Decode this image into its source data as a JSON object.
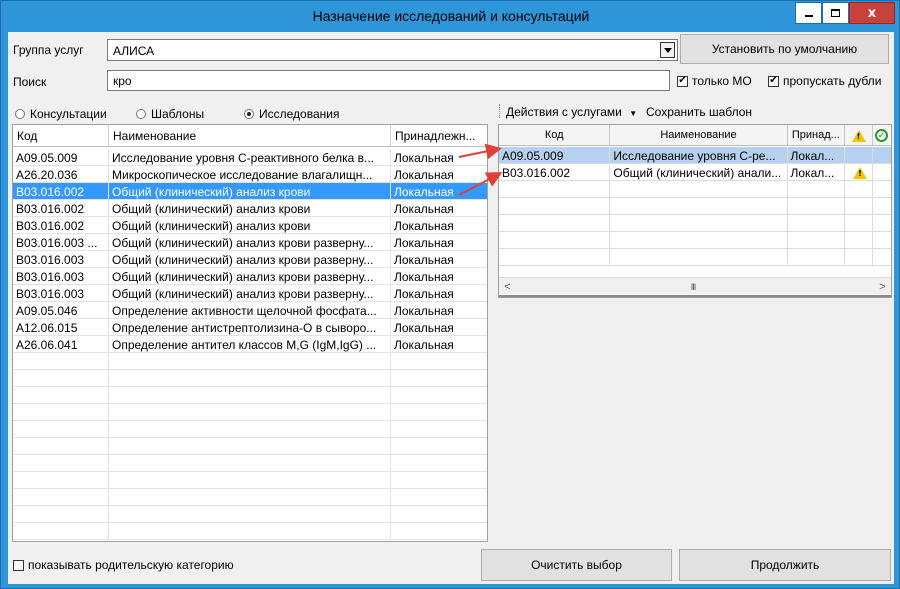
{
  "window": {
    "title": "Назначение исследований и консультаций",
    "close_glyph": "x"
  },
  "form": {
    "group_label": "Группа услуг",
    "group_value": "АЛИСА",
    "default_button": "Установить по умолчанию",
    "search_label": "Поиск",
    "search_value": "кро",
    "only_mo_label": "только МО",
    "only_mo_checked": true,
    "skip_dup_label": "пропускать дубли",
    "skip_dup_checked": true
  },
  "radios": [
    {
      "label": "Консультации",
      "selected": false
    },
    {
      "label": "Шаблоны",
      "selected": false
    },
    {
      "label": "Исследования",
      "selected": true
    }
  ],
  "left_grid": {
    "columns": [
      "Код",
      "Наименование",
      "Принадлежн..."
    ],
    "rows": [
      {
        "code": "A09.05.009",
        "name": "Исследование уровня С-реактивного белка в...",
        "owner": "Локальная",
        "selected": false
      },
      {
        "code": "A26.20.036",
        "name": "Микроскопическое исследование влагалищн...",
        "owner": "Локальная",
        "selected": false
      },
      {
        "code": "B03.016.002",
        "name": "Общий (клинический) анализ крови",
        "owner": "Локальная",
        "selected": true
      },
      {
        "code": "B03.016.002",
        "name": "Общий (клинический) анализ крови",
        "owner": "Локальная",
        "selected": false
      },
      {
        "code": "B03.016.002",
        "name": "Общий (клинический) анализ крови",
        "owner": "Локальная",
        "selected": false
      },
      {
        "code": "B03.016.003 ...",
        "name": "Общий (клинический) анализ крови разверну...",
        "owner": "Локальная",
        "selected": false
      },
      {
        "code": "B03.016.003",
        "name": "Общий (клинический) анализ крови разверну...",
        "owner": "Локальная",
        "selected": false
      },
      {
        "code": "B03.016.003",
        "name": "Общий (клинический) анализ крови разверну...",
        "owner": "Локальная",
        "selected": false
      },
      {
        "code": "B03.016.003",
        "name": "Общий (клинический) анализ крови разверну...",
        "owner": "Локальная",
        "selected": false
      },
      {
        "code": "A09.05.046",
        "name": "Определение активности щелочной фосфата...",
        "owner": "Локальная",
        "selected": false
      },
      {
        "code": "A12.06.015",
        "name": "Определение антистрептолизина-О в сыворо...",
        "owner": "Локальная",
        "selected": false
      },
      {
        "code": "A26.06.041",
        "name": "Определение антител классов M,G (IgM,IgG) ...",
        "owner": "Локальная",
        "selected": false
      }
    ]
  },
  "toolbar": {
    "actions": "Действия с услугами",
    "save_template": "Сохранить шаблон"
  },
  "right_grid": {
    "columns": [
      "Код",
      "Наименование",
      "Принад..."
    ],
    "rows": [
      {
        "code": "A09.05.009",
        "name": "Исследование уровня С-ре...",
        "owner": "Локал...",
        "warning": false,
        "selected": true
      },
      {
        "code": "B03.016.002",
        "name": "Общий (клинический) анали...",
        "owner": "Локал...",
        "warning": true,
        "selected": false
      }
    ],
    "scroll_thumb": "III"
  },
  "bottom": {
    "show_parent_label": "показывать родительскую категорию",
    "show_parent_checked": false,
    "clear_button": "Очистить выбор",
    "continue_button": "Продолжить"
  },
  "colors": {
    "selection": "#3399ff",
    "right_selection": "#b6d1ef",
    "arrow": "#e0403a",
    "title_bg": "#2d95d8"
  }
}
